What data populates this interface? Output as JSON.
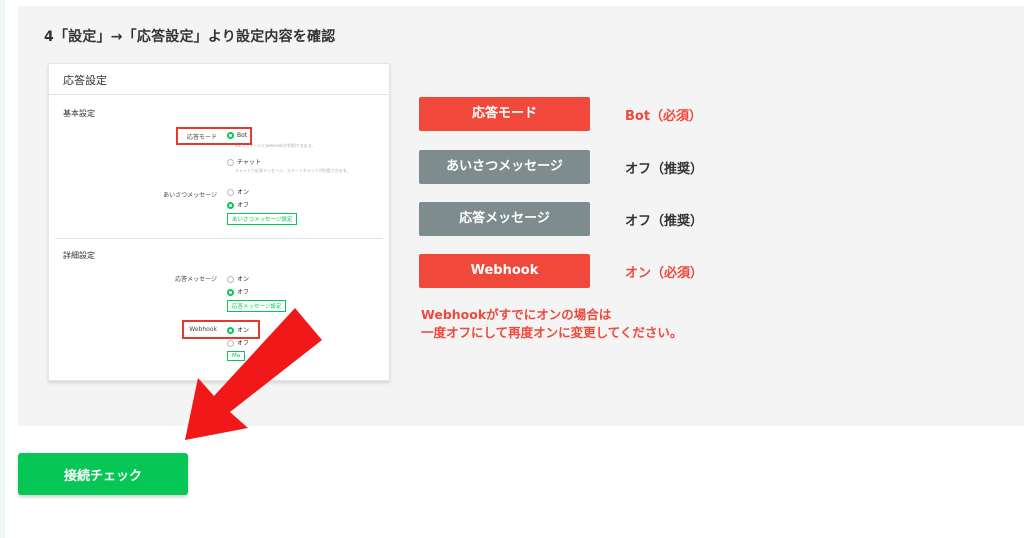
{
  "step_title": "4「設定」→「応答設定」より設定内容を確認",
  "screenshot": {
    "header": "応答設定",
    "basic_section": "基本設定",
    "response_mode_label": "応答モード",
    "bot_option": "Bot",
    "bot_hint": "Botメッセージとwebhookが利用できます。",
    "chat_option": "チャット",
    "chat_hint": "チャットで応答メッセージ、スマートチャットが利用できます。",
    "greeting_label": "あいさつメッセージ",
    "on_option": "オン",
    "off_option": "オフ",
    "greeting_settings_button": "あいさつメッセージ設定",
    "detail_section": "詳細設定",
    "auto_reply_label": "応答メッセージ",
    "auto_reply_settings_button": "応答メッセージ設定",
    "webhook_label": "Webhook",
    "webhook_settings_button_partial": "Ma"
  },
  "legend": [
    {
      "label": "応答モード",
      "value": "Bot（必須）",
      "color": "#f0483a",
      "required": true
    },
    {
      "label": "あいさつメッセージ",
      "value": "オフ（推奨）",
      "color": "#7f8c8d",
      "required": false
    },
    {
      "label": "応答メッセージ",
      "value": "オフ（推奨）",
      "color": "#7f8c8d",
      "required": false
    },
    {
      "label": "Webhook",
      "value": "オン（必須）",
      "color": "#f0483a",
      "required": true
    }
  ],
  "note_line1": "Webhookがすでにオンの場合は",
  "note_line2": "一度オフにして再度オンに変更してください。",
  "connect_check_button": "接続チェック",
  "colors": {
    "accent_green": "#06c755",
    "alert_red": "#f0483a",
    "neutral_gray": "#7f8c8d"
  },
  "icons": [
    "arrow-pointer-icon"
  ]
}
